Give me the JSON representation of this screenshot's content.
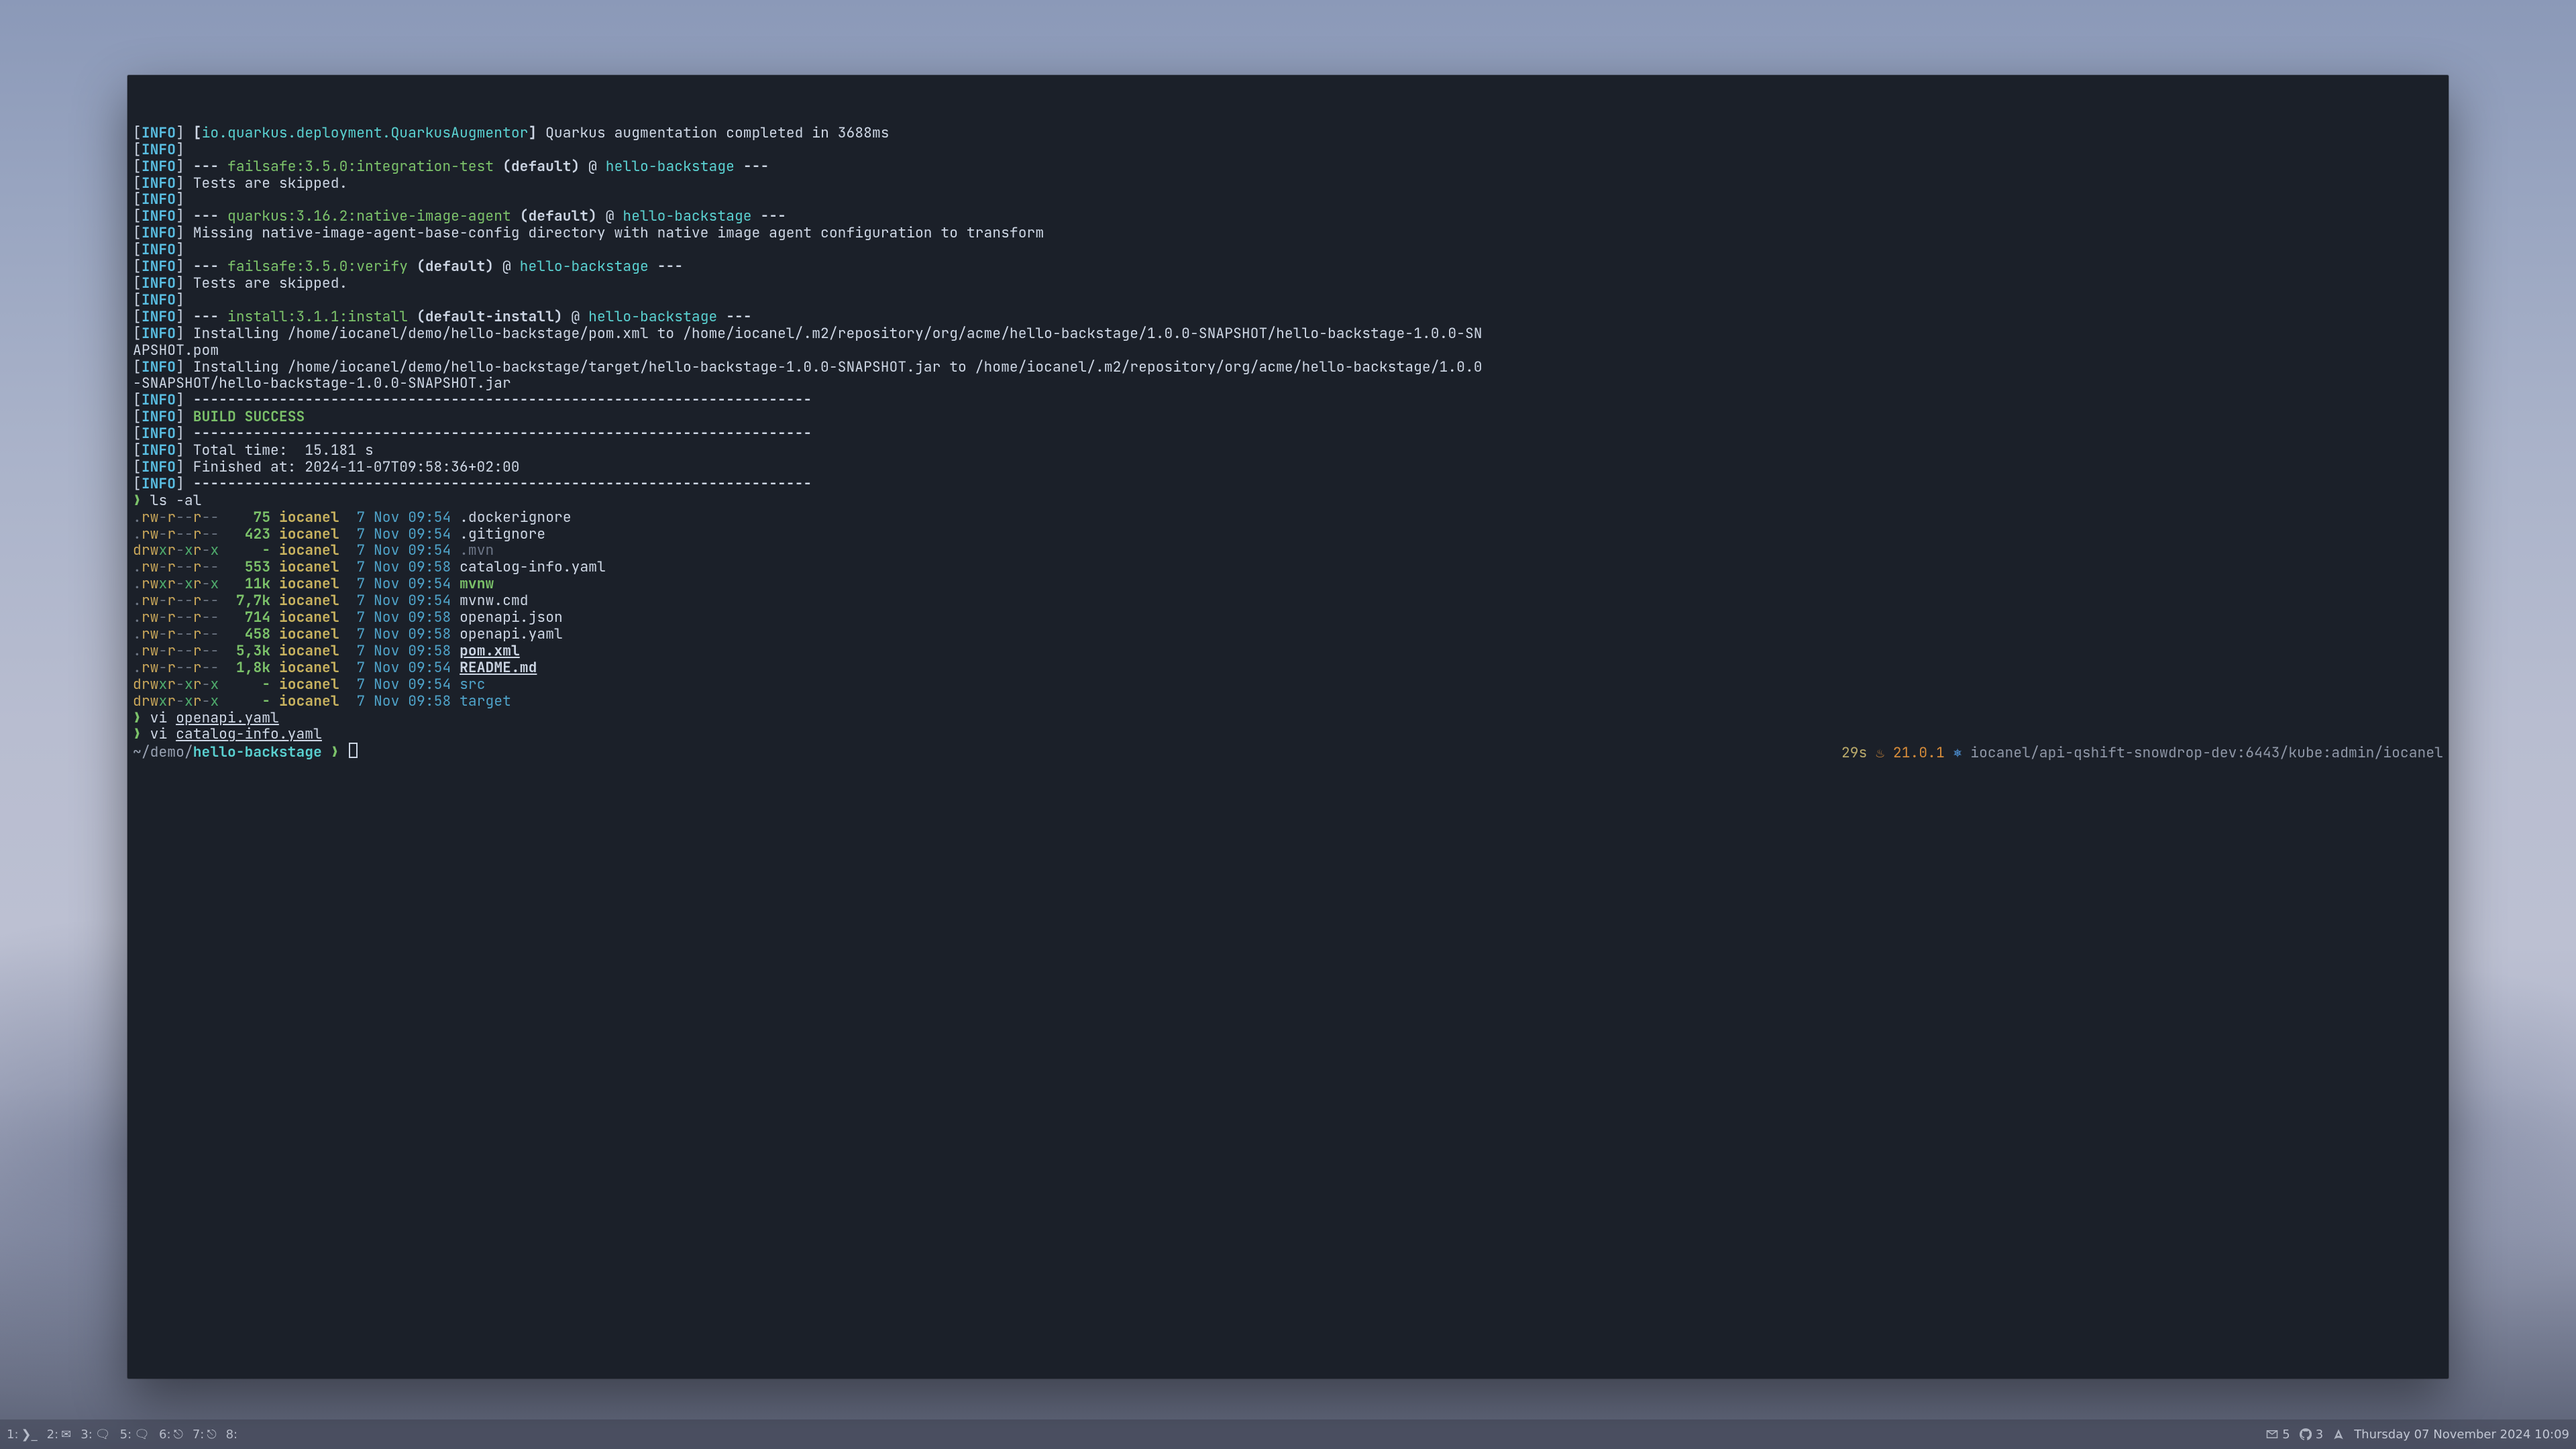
{
  "wallpaper": {
    "theme": "misty-landscape"
  },
  "terminal": {
    "log": [
      {
        "prefix": "INFO",
        "segs": [
          {
            "c": "plain",
            "t": " "
          },
          {
            "c": "bold",
            "t": "["
          },
          {
            "c": "cyan",
            "t": "io.quarkus.deployment.QuarkusAugmentor"
          },
          {
            "c": "bold",
            "t": "]"
          },
          {
            "c": "plain",
            "t": " Quarkus augmentation completed in 3688ms"
          }
        ]
      },
      {
        "prefix": "INFO",
        "segs": []
      },
      {
        "prefix": "INFO",
        "segs": [
          {
            "c": "bold",
            "t": " --- "
          },
          {
            "c": "green",
            "t": "failsafe:3.5.0:integration-test"
          },
          {
            "c": "bold",
            "t": " (default)"
          },
          {
            "c": "plain",
            "t": " @ "
          },
          {
            "c": "cyan",
            "t": "hello-backstage"
          },
          {
            "c": "bold",
            "t": " ---"
          }
        ]
      },
      {
        "prefix": "INFO",
        "segs": [
          {
            "c": "plain",
            "t": " Tests are skipped."
          }
        ]
      },
      {
        "prefix": "INFO",
        "segs": []
      },
      {
        "prefix": "INFO",
        "segs": [
          {
            "c": "bold",
            "t": " --- "
          },
          {
            "c": "green",
            "t": "quarkus:3.16.2:native-image-agent"
          },
          {
            "c": "bold",
            "t": " (default)"
          },
          {
            "c": "plain",
            "t": " @ "
          },
          {
            "c": "cyan",
            "t": "hello-backstage"
          },
          {
            "c": "bold",
            "t": " ---"
          }
        ]
      },
      {
        "prefix": "INFO",
        "segs": [
          {
            "c": "plain",
            "t": " Missing native-image-agent-base-config directory with native image agent configuration to transform"
          }
        ]
      },
      {
        "prefix": "INFO",
        "segs": []
      },
      {
        "prefix": "INFO",
        "segs": [
          {
            "c": "bold",
            "t": " --- "
          },
          {
            "c": "green",
            "t": "failsafe:3.5.0:verify"
          },
          {
            "c": "bold",
            "t": " (default)"
          },
          {
            "c": "plain",
            "t": " @ "
          },
          {
            "c": "cyan",
            "t": "hello-backstage"
          },
          {
            "c": "bold",
            "t": " ---"
          }
        ]
      },
      {
        "prefix": "INFO",
        "segs": [
          {
            "c": "plain",
            "t": " Tests are skipped."
          }
        ]
      },
      {
        "prefix": "INFO",
        "segs": []
      },
      {
        "prefix": "INFO",
        "segs": [
          {
            "c": "bold",
            "t": " --- "
          },
          {
            "c": "green",
            "t": "install:3.1.1:install"
          },
          {
            "c": "bold",
            "t": " (default-install)"
          },
          {
            "c": "plain",
            "t": " @ "
          },
          {
            "c": "cyan",
            "t": "hello-backstage"
          },
          {
            "c": "bold",
            "t": " ---"
          }
        ]
      },
      {
        "prefix": "INFO",
        "segs": [
          {
            "c": "plain",
            "t": " Installing /home/iocanel/demo/hello-backstage/pom.xml to /home/iocanel/.m2/repository/org/acme/hello-backstage/1.0.0-SNAPSHOT/hello-backstage-1.0.0-SN"
          }
        ]
      },
      {
        "raw": true,
        "segs": [
          {
            "c": "plain",
            "t": "APSHOT.pom"
          }
        ]
      },
      {
        "prefix": "INFO",
        "segs": [
          {
            "c": "plain",
            "t": " Installing /home/iocanel/demo/hello-backstage/target/hello-backstage-1.0.0-SNAPSHOT.jar to /home/iocanel/.m2/repository/org/acme/hello-backstage/1.0.0"
          }
        ]
      },
      {
        "raw": true,
        "segs": [
          {
            "c": "plain",
            "t": "-SNAPSHOT/hello-backstage-1.0.0-SNAPSHOT.jar"
          }
        ]
      },
      {
        "prefix": "INFO",
        "segs": [
          {
            "c": "bold",
            "t": " ------------------------------------------------------------------------"
          }
        ]
      },
      {
        "prefix": "INFO",
        "segs": [
          {
            "c": "plain",
            "t": " "
          },
          {
            "c": "green-b",
            "t": "BUILD SUCCESS"
          }
        ]
      },
      {
        "prefix": "INFO",
        "segs": [
          {
            "c": "bold",
            "t": " ------------------------------------------------------------------------"
          }
        ]
      },
      {
        "prefix": "INFO",
        "segs": [
          {
            "c": "plain",
            "t": " Total time:  15.181 s"
          }
        ]
      },
      {
        "prefix": "INFO",
        "segs": [
          {
            "c": "plain",
            "t": " Finished at: 2024-11-07T09:58:36+02:00"
          }
        ]
      },
      {
        "prefix": "INFO",
        "segs": [
          {
            "c": "bold",
            "t": " ------------------------------------------------------------------------"
          }
        ]
      }
    ],
    "commands": [
      {
        "cmd": "ls -al"
      }
    ],
    "ls": [
      {
        "perm": ".rw-r--r--",
        "size": "75",
        "owner": "iocanel",
        "date": "7 Nov 09:54",
        "name": ".dockerignore",
        "cls": "file"
      },
      {
        "perm": ".rw-r--r--",
        "size": "423",
        "owner": "iocanel",
        "date": "7 Nov 09:54",
        "name": ".gitignore",
        "cls": "file"
      },
      {
        "perm": "drwxr-xr-x",
        "size": "-",
        "owner": "iocanel",
        "date": "7 Nov 09:54",
        "name": ".mvn",
        "cls": "mvn"
      },
      {
        "perm": ".rw-r--r--",
        "size": "553",
        "owner": "iocanel",
        "date": "7 Nov 09:58",
        "name": "catalog-info.yaml",
        "cls": "file"
      },
      {
        "perm": ".rwxr-xr-x",
        "size": "11k",
        "owner": "iocanel",
        "date": "7 Nov 09:54",
        "name": "mvnw",
        "cls": "exe"
      },
      {
        "perm": ".rw-r--r--",
        "size": "7,7k",
        "owner": "iocanel",
        "date": "7 Nov 09:54",
        "name": "mvnw.cmd",
        "cls": "file"
      },
      {
        "perm": ".rw-r--r--",
        "size": "714",
        "owner": "iocanel",
        "date": "7 Nov 09:58",
        "name": "openapi.json",
        "cls": "file"
      },
      {
        "perm": ".rw-r--r--",
        "size": "458",
        "owner": "iocanel",
        "date": "7 Nov 09:58",
        "name": "openapi.yaml",
        "cls": "file"
      },
      {
        "perm": ".rw-r--r--",
        "size": "5,3k",
        "owner": "iocanel",
        "date": "7 Nov 09:58",
        "name": "pom.xml",
        "cls": "link-bold"
      },
      {
        "perm": ".rw-r--r--",
        "size": "1,8k",
        "owner": "iocanel",
        "date": "7 Nov 09:54",
        "name": "README.md",
        "cls": "link-bold"
      },
      {
        "perm": "drwxr-xr-x",
        "size": "-",
        "owner": "iocanel",
        "date": "7 Nov 09:54",
        "name": "src",
        "cls": "dirname"
      },
      {
        "perm": "drwxr-xr-x",
        "size": "-",
        "owner": "iocanel",
        "date": "7 Nov 09:58",
        "name": "target",
        "cls": "dirname"
      }
    ],
    "history": [
      {
        "text": "vi ",
        "arg": "openapi.yaml"
      },
      {
        "text": "vi ",
        "arg": "catalog-info.yaml"
      }
    ],
    "prompt": {
      "path_dim": "~/demo/",
      "path_cur": "hello-backstage",
      "arrow": "❯",
      "elapsed": "29s",
      "java_icon": "♨",
      "java_version": "21.0.1",
      "k8s_icon": "⎈",
      "k8s_ctx": "iocanel/api-qshift-snowdrop-dev:6443/kube:admin/iocanel"
    }
  },
  "taskbar": {
    "workspaces": [
      {
        "num": "1:",
        "glyph": "❯_"
      },
      {
        "num": "2:",
        "glyph": "✉"
      },
      {
        "num": "3:",
        "glyph": "🗨"
      },
      {
        "num": "5:",
        "glyph": "🗨"
      },
      {
        "num": "6:",
        "glyph": "⎋"
      },
      {
        "num": "7:",
        "glyph": "⎋"
      },
      {
        "num": "8:",
        "glyph": ""
      }
    ],
    "tray": {
      "mail_count": "5",
      "github_count": "3",
      "arch": true
    },
    "clock": "Thursday 07 November 2024 10:09"
  }
}
